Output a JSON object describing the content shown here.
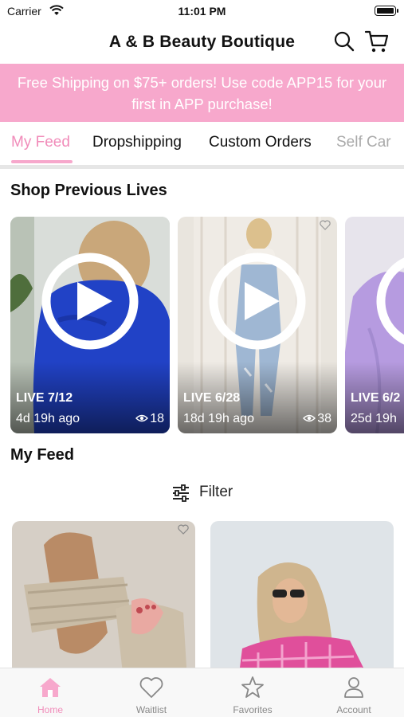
{
  "status_bar": {
    "carrier": "Carrier",
    "time": "11:01 PM"
  },
  "nav": {
    "title": "A & B Beauty Boutique",
    "search_icon": "search-icon",
    "cart_icon": "cart-icon"
  },
  "promo": {
    "line1": "Free Shipping on $75+ orders! Use code APP15 for your",
    "line2": "first in APP purchase!"
  },
  "tabs": [
    {
      "label": "My Feed",
      "active": true
    },
    {
      "label": "Dropshipping"
    },
    {
      "label": "Custom Orders"
    },
    {
      "label": "Self Car"
    }
  ],
  "sections": {
    "previous_lives": "Shop Previous Lives",
    "my_feed": "My Feed"
  },
  "lives": [
    {
      "label": "LIVE 7/12",
      "ago": "4d 19h ago",
      "views": "18"
    },
    {
      "label": "LIVE 6/28",
      "ago": "18d 19h ago",
      "views": "38"
    },
    {
      "label": "LIVE 6/2",
      "ago": "25d 19h",
      "views": ""
    }
  ],
  "filter": {
    "label": "Filter"
  },
  "tabbar": [
    {
      "label": "Home",
      "icon": "home-icon",
      "active": true
    },
    {
      "label": "Waitlist",
      "icon": "heart-icon"
    },
    {
      "label": "Favorites",
      "icon": "star-icon"
    },
    {
      "label": "Account",
      "icon": "person-icon"
    }
  ],
  "colors": {
    "accent": "#f7a8cc",
    "accent_text": "#f18cba"
  }
}
